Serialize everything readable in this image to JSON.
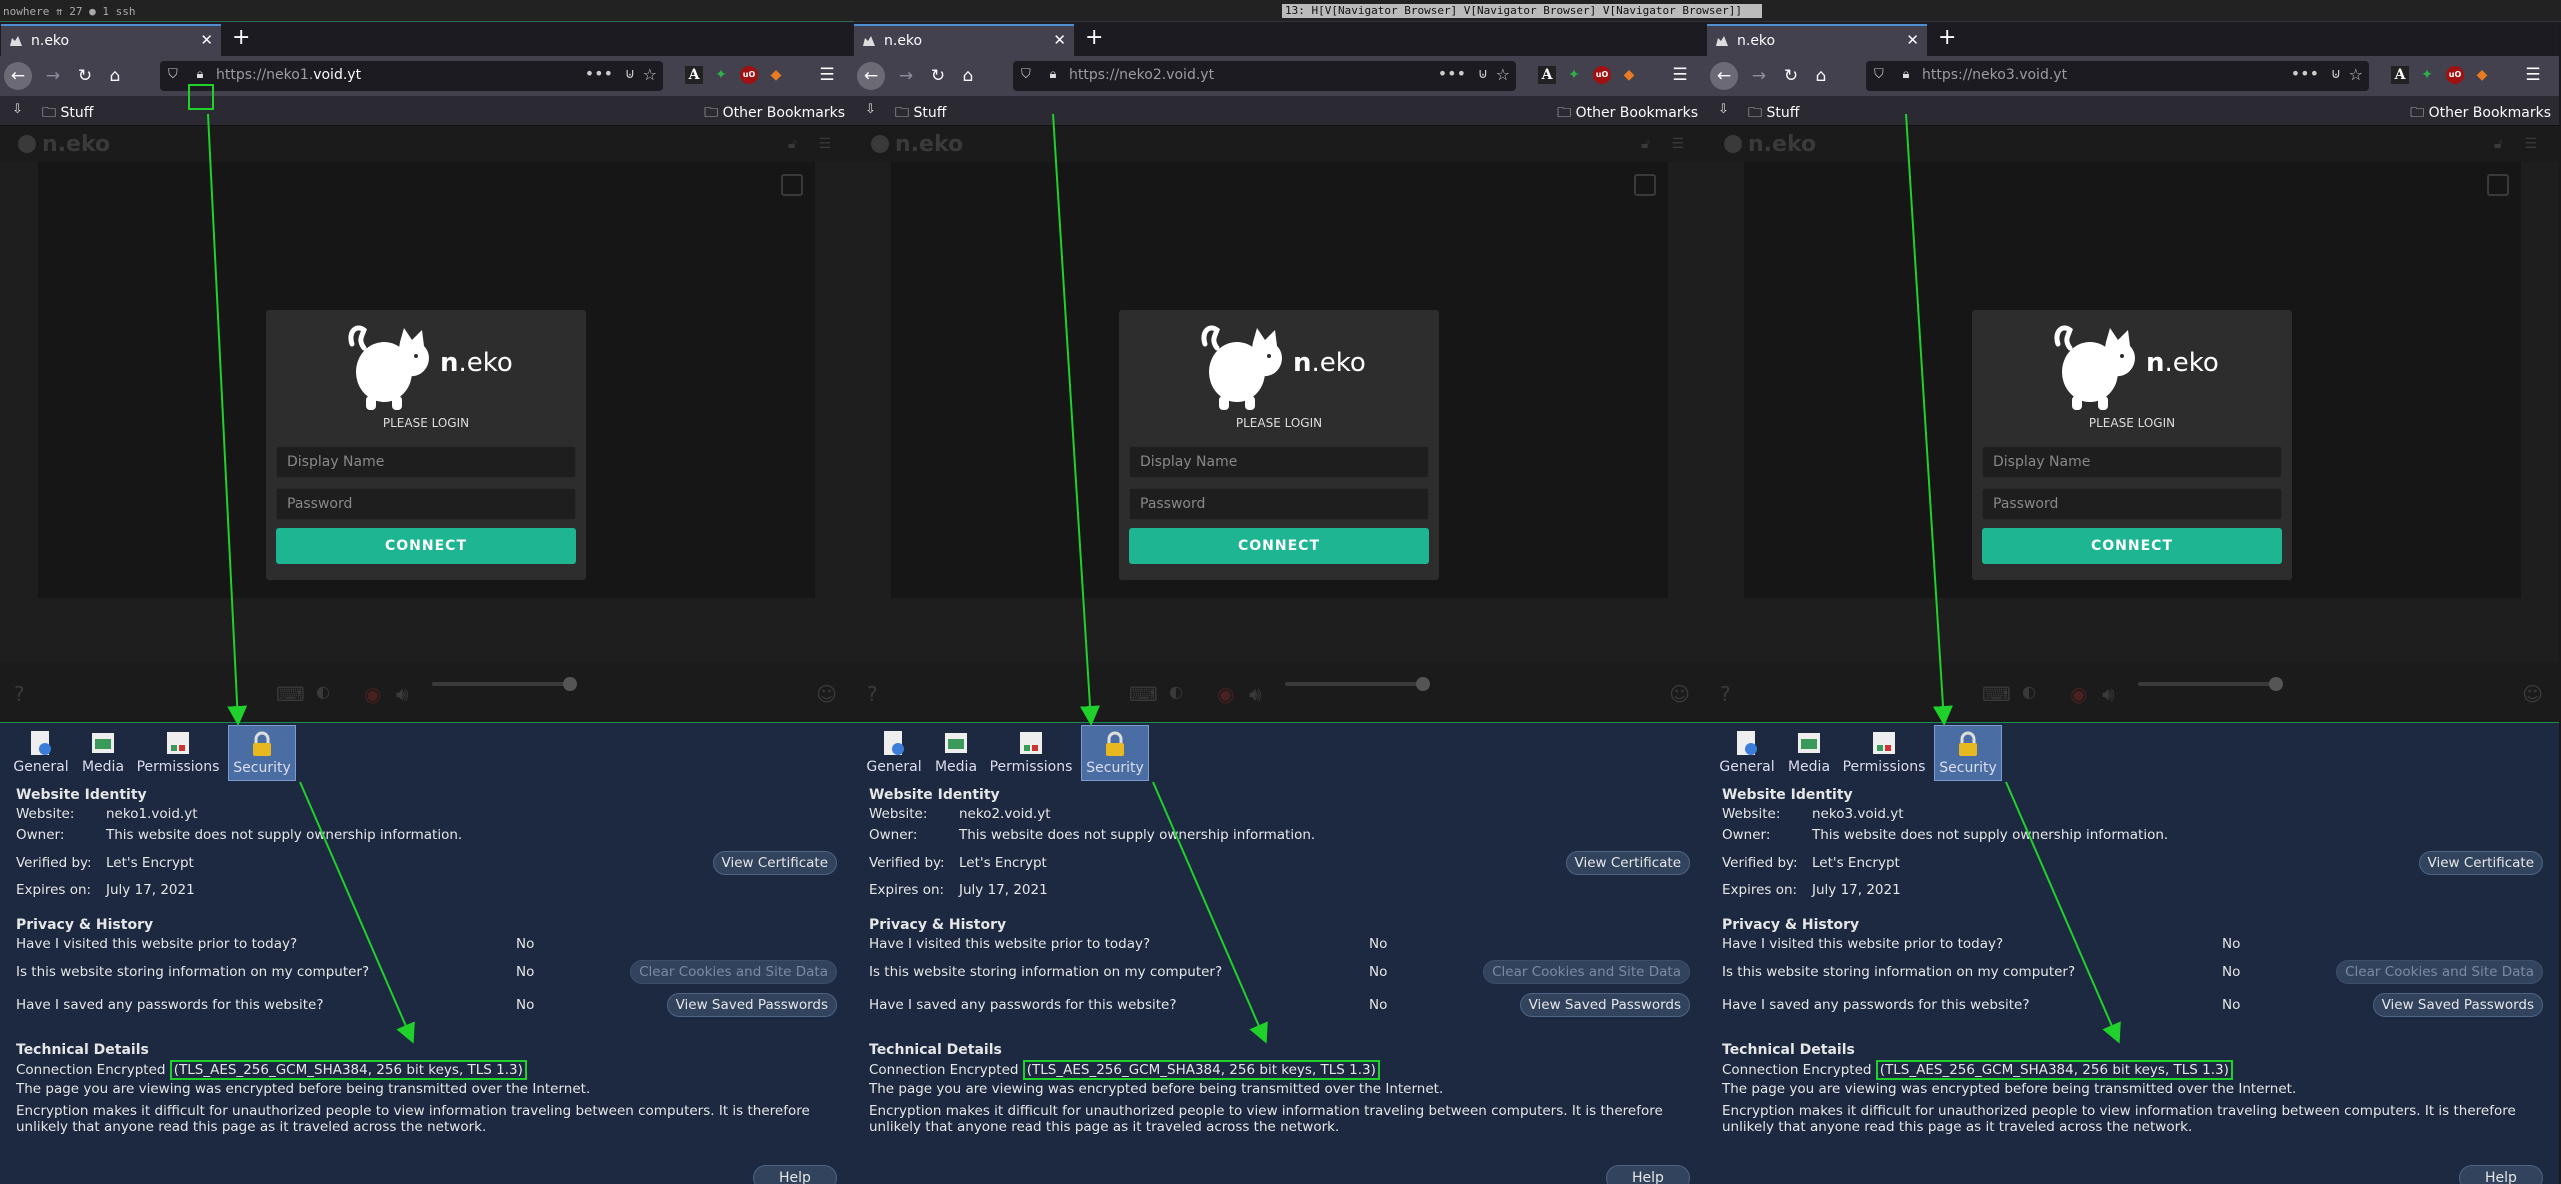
{
  "wm": {
    "left": "nowhere ⇈ 27 ● 1 ssh",
    "right": "13: H[V[Navigator Browser] V[Navigator Browser] V[Navigator Browser]]"
  },
  "panes": [
    {
      "tab_title": "n.eko",
      "url_prefix": "https://neko1.",
      "url_domain": "void.yt",
      "website": "neko1.void.yt"
    },
    {
      "tab_title": "n.eko",
      "url_prefix": "https://neko2.void.yt",
      "url_domain": "",
      "website": "neko2.void.yt"
    },
    {
      "tab_title": "n.eko",
      "url_prefix": "https://neko3.void.yt",
      "url_domain": "",
      "website": "neko3.void.yt"
    }
  ],
  "bookmarks": {
    "folder": "Stuff",
    "other": "Other Bookmarks"
  },
  "login": {
    "brand_bold": "n",
    "brand_rest": ".eko",
    "please_login": "PLEASE LOGIN",
    "display_name_placeholder": "Display Name",
    "password_placeholder": "Password",
    "connect": "CONNECT"
  },
  "page_info": {
    "tabs": [
      "General",
      "Media",
      "Permissions",
      "Security"
    ],
    "selected_tab": "Security",
    "identity_heading": "Website Identity",
    "website_label": "Website:",
    "owner_label": "Owner:",
    "owner_value": "This website does not supply ownership information.",
    "verified_label": "Verified by:",
    "verified_value": "Let's Encrypt",
    "view_certificate": "View Certificate",
    "expires_label": "Expires on:",
    "expires_value": "July 17, 2021",
    "privacy_heading": "Privacy & History",
    "q1": "Have I visited this website prior to today?",
    "a1": "No",
    "q2": "Is this website storing information on my computer?",
    "a2": "No",
    "clear_cookies": "Clear Cookies and Site Data",
    "q3": "Have I saved any passwords for this website?",
    "a3": "No",
    "view_passwords": "View Saved Passwords",
    "tech_heading": "Technical Details",
    "conn_label": "Connection Encrypted",
    "cipher": "(TLS_AES_256_GCM_SHA384, 256 bit keys, TLS 1.3)",
    "para1": "The page you are viewing was encrypted before being transmitted over the Internet.",
    "para2": "Encryption makes it difficult for unauthorized people to view information traveling between computers. It is therefore unlikely that anyone read this page as it traveled across the network.",
    "help": "Help"
  },
  "colors": {
    "annotation": "#1fd12a",
    "connect": "#1eb592",
    "selected_tab": "#4a6ea3"
  }
}
